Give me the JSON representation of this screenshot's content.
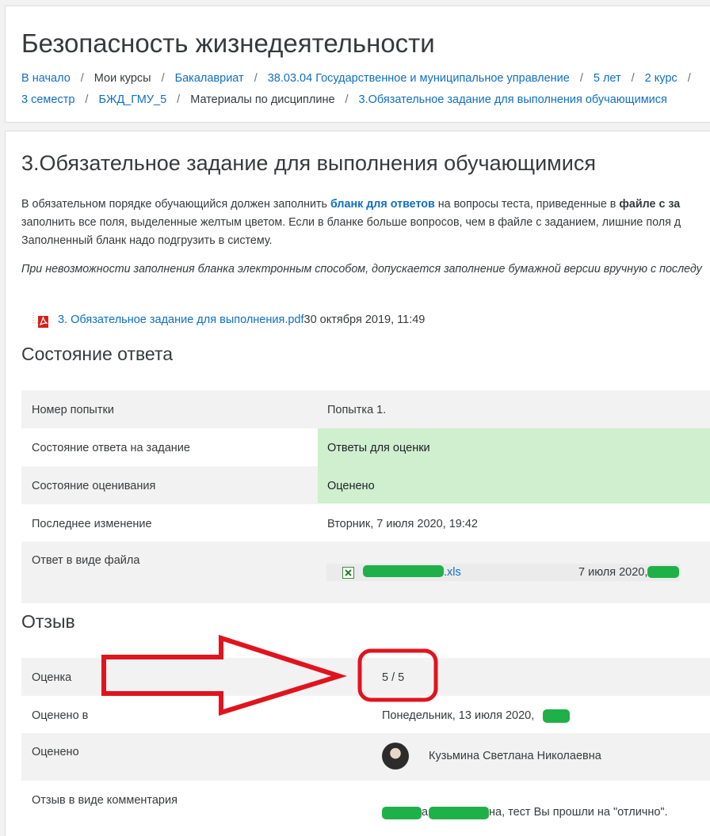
{
  "header": {
    "site_title": "Безопасность жизнедеятельности",
    "breadcrumb": [
      {
        "label": "В начало",
        "link": true
      },
      {
        "label": "Мои курсы",
        "link": false
      },
      {
        "label": "Бакалавриат",
        "link": true
      },
      {
        "label": "38.03.04 Государственное и муниципальное управление",
        "link": true
      },
      {
        "label": "5 лет",
        "link": true
      },
      {
        "label": "2 курс",
        "link": true
      },
      {
        "label": "3 семестр",
        "link": true
      },
      {
        "label": "БЖД_ГМУ_5",
        "link": true
      },
      {
        "label": "Материалы по дисциплине",
        "link": false
      },
      {
        "label": "3.Обязательное задание для выполнения обучающимися",
        "link": true
      }
    ],
    "separator": "/"
  },
  "assignment": {
    "title": "3.Обязательное задание для выполнения обучающимися",
    "intro_line1_a": "В обязательном порядке обучающийся должен заполнить ",
    "intro_link": "бланк для ответов",
    "intro_line1_b": " на вопросы теста, приведенные в ",
    "intro_bold": "файле с за",
    "intro_line2": "заполнить все поля, выделенные желтым цветом. Если в бланке больше вопросов, чем в файле с заданием, лишние поля д",
    "intro_line3": "Заполненный бланк надо подгрузить в систему.",
    "intro_italic": "При невозможности заполнения бланка электронным способом, допускается заполнение бумажной версии вручную с последу",
    "attachment_name": "3. Обязательное задание для выполнения.pdf",
    "attachment_date": "30 октября 2019, 11:49"
  },
  "submission": {
    "section_title": "Состояние ответа",
    "rows": [
      {
        "label": "Номер попытки",
        "value": "Попытка 1."
      },
      {
        "label": "Состояние ответа на задание",
        "value": "Ответы для оценки"
      },
      {
        "label": "Состояние оценивания",
        "value": "Оценено"
      },
      {
        "label": "Последнее изменение",
        "value": "Вторник, 7 июля 2020, 19:42"
      },
      {
        "label": "Ответ в виде файла",
        "file_ext": ".xls",
        "file_date": "7 июля 2020,"
      }
    ]
  },
  "feedback": {
    "section_title": "Отзыв",
    "rows": [
      {
        "label": "Оценка",
        "value": "5 / 5"
      },
      {
        "label": "Оценено в",
        "value": "Понедельник, 13 июля 2020,"
      },
      {
        "label": "Оценено",
        "value": "Кузьмина Светлана Николаевна"
      },
      {
        "label": "Отзыв в виде комментария",
        "value_a": "а",
        "value_b": "на, тест Вы прошли на \"отлично\"."
      }
    ]
  },
  "colors": {
    "link": "#0f6fc5",
    "status_green": "#cfefcf",
    "annotation_red": "#e0141e",
    "redaction_green": "#1fb04a"
  }
}
